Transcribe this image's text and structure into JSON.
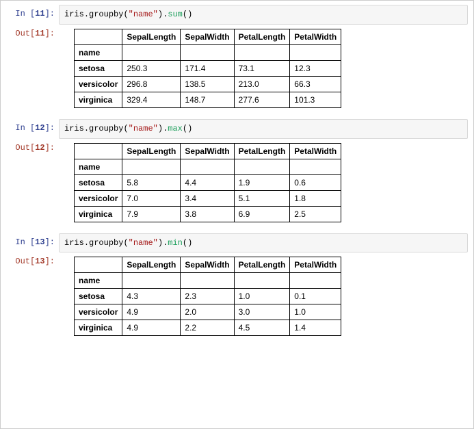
{
  "prompts": {
    "in_prefix": "In [",
    "in_suffix": "]:",
    "out_prefix": "Out[",
    "out_suffix": "]:"
  },
  "cells": [
    {
      "exec_count": "11",
      "code": {
        "obj": "iris",
        "dot1": ".",
        "call1": "groupby",
        "open1": "(",
        "str": "\"name\"",
        "close1": ")",
        "dot2": ".",
        "method": "sum",
        "parens": "()"
      },
      "table": {
        "index_name": "name",
        "columns": [
          "SepalLength",
          "SepalWidth",
          "PetalLength",
          "PetalWidth"
        ],
        "rows": [
          {
            "name": "setosa",
            "vals": [
              "250.3",
              "171.4",
              "73.1",
              "12.3"
            ]
          },
          {
            "name": "versicolor",
            "vals": [
              "296.8",
              "138.5",
              "213.0",
              "66.3"
            ]
          },
          {
            "name": "virginica",
            "vals": [
              "329.4",
              "148.7",
              "277.6",
              "101.3"
            ]
          }
        ]
      }
    },
    {
      "exec_count": "12",
      "code": {
        "obj": "iris",
        "dot1": ".",
        "call1": "groupby",
        "open1": "(",
        "str": "\"name\"",
        "close1": ")",
        "dot2": ".",
        "method": "max",
        "parens": "()"
      },
      "table": {
        "index_name": "name",
        "columns": [
          "SepalLength",
          "SepalWidth",
          "PetalLength",
          "PetalWidth"
        ],
        "rows": [
          {
            "name": "setosa",
            "vals": [
              "5.8",
              "4.4",
              "1.9",
              "0.6"
            ]
          },
          {
            "name": "versicolor",
            "vals": [
              "7.0",
              "3.4",
              "5.1",
              "1.8"
            ]
          },
          {
            "name": "virginica",
            "vals": [
              "7.9",
              "3.8",
              "6.9",
              "2.5"
            ]
          }
        ]
      }
    },
    {
      "exec_count": "13",
      "code": {
        "obj": "iris",
        "dot1": ".",
        "call1": "groupby",
        "open1": "(",
        "str": "\"name\"",
        "close1": ")",
        "dot2": ".",
        "method": "min",
        "parens": "()"
      },
      "table": {
        "index_name": "name",
        "columns": [
          "SepalLength",
          "SepalWidth",
          "PetalLength",
          "PetalWidth"
        ],
        "rows": [
          {
            "name": "setosa",
            "vals": [
              "4.3",
              "2.3",
              "1.0",
              "0.1"
            ]
          },
          {
            "name": "versicolor",
            "vals": [
              "4.9",
              "2.0",
              "3.0",
              "1.0"
            ]
          },
          {
            "name": "virginica",
            "vals": [
              "4.9",
              "2.2",
              "4.5",
              "1.4"
            ]
          }
        ]
      }
    }
  ]
}
